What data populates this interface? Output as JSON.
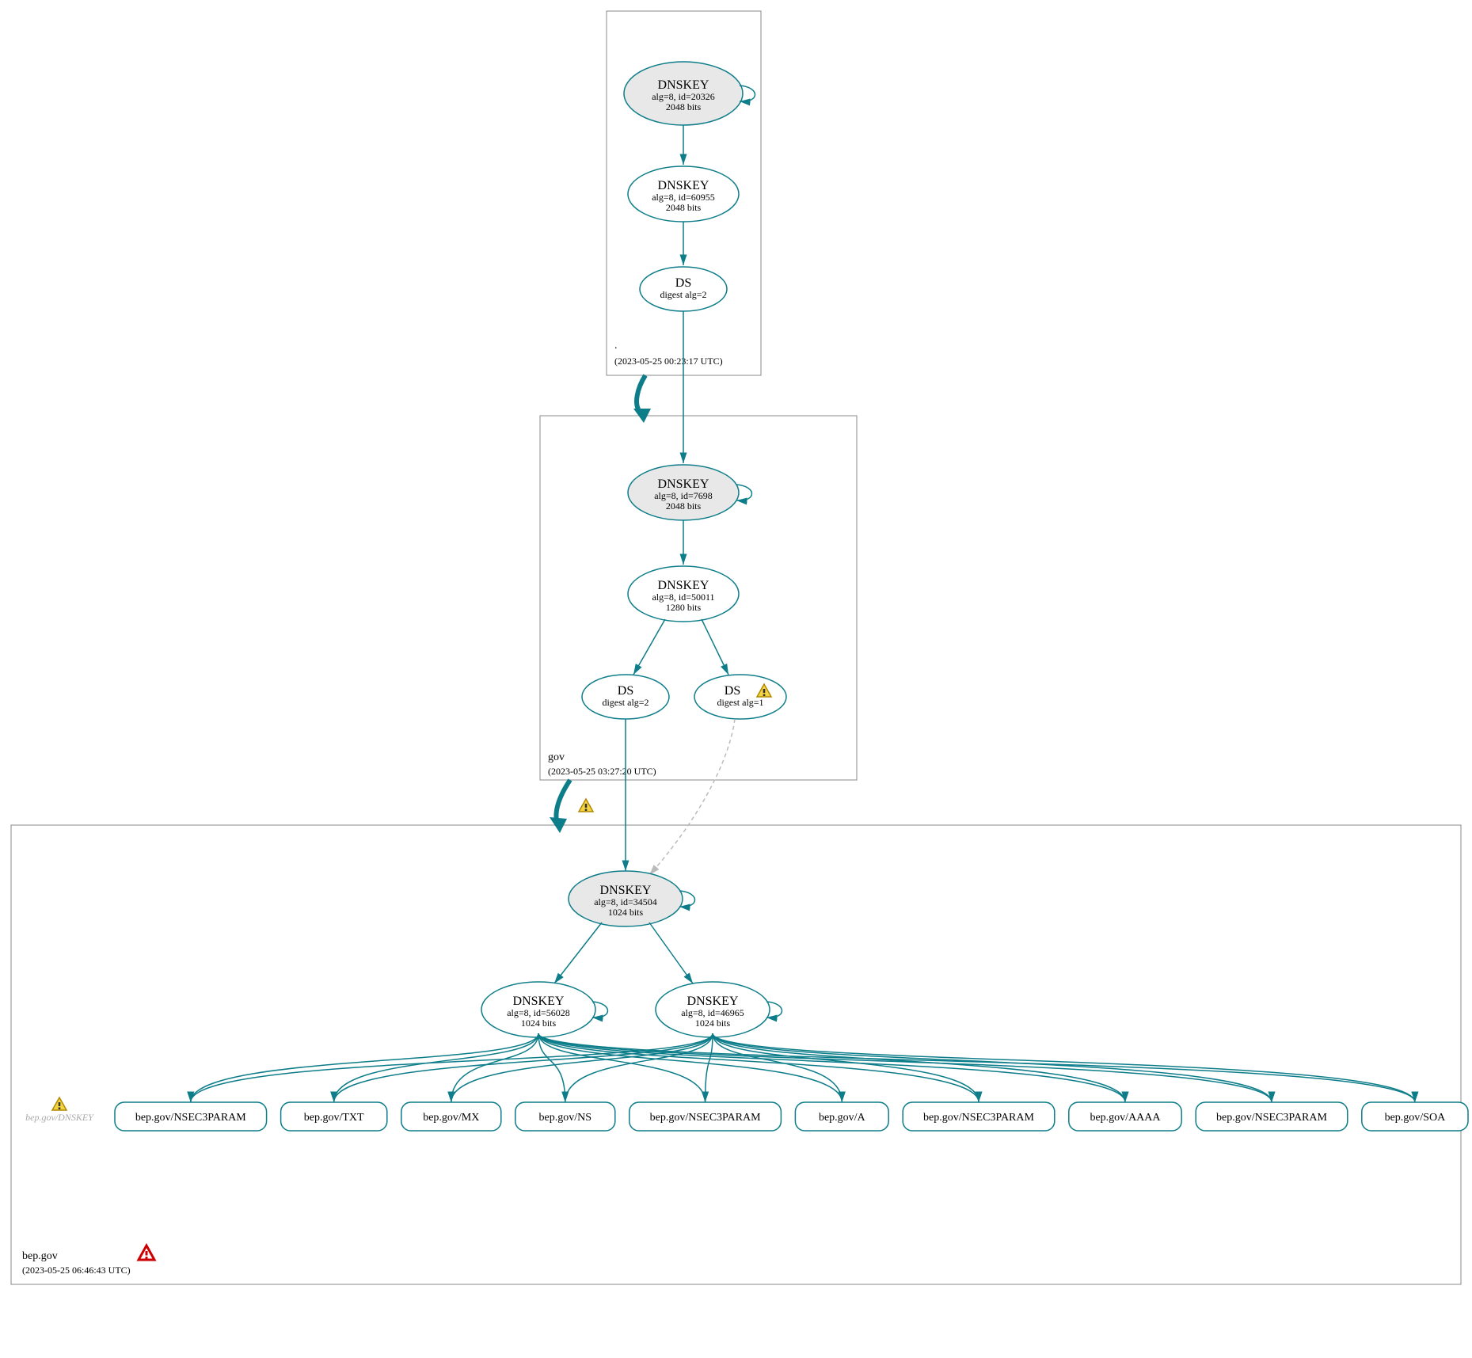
{
  "zones": {
    "root": {
      "name": ".",
      "timestamp": "(2023-05-25 00:23:17 UTC)",
      "nodes": {
        "ksk": {
          "title": "DNSKEY",
          "sub1": "alg=8, id=20326",
          "sub2": "2048 bits"
        },
        "zsk": {
          "title": "DNSKEY",
          "sub1": "alg=8, id=60955",
          "sub2": "2048 bits"
        },
        "ds": {
          "title": "DS",
          "sub1": "digest alg=2"
        }
      }
    },
    "gov": {
      "name": "gov",
      "timestamp": "(2023-05-25 03:27:20 UTC)",
      "nodes": {
        "ksk": {
          "title": "DNSKEY",
          "sub1": "alg=8, id=7698",
          "sub2": "2048 bits"
        },
        "zsk": {
          "title": "DNSKEY",
          "sub1": "alg=8, id=50011",
          "sub2": "1280 bits"
        },
        "ds1": {
          "title": "DS",
          "sub1": "digest alg=2"
        },
        "ds2": {
          "title": "DS",
          "sub1": "digest alg=1"
        }
      }
    },
    "bep": {
      "name": "bep.gov",
      "timestamp": "(2023-05-25 06:46:43 UTC)",
      "nodes": {
        "ksk": {
          "title": "DNSKEY",
          "sub1": "alg=8, id=34504",
          "sub2": "1024 bits"
        },
        "zsk1": {
          "title": "DNSKEY",
          "sub1": "alg=8, id=56028",
          "sub2": "1024 bits"
        },
        "zsk2": {
          "title": "DNSKEY",
          "sub1": "alg=8, id=46965",
          "sub2": "1024 bits"
        }
      },
      "extra_dnskey_label": "bep.gov/DNSKEY",
      "rrsets": [
        "bep.gov/NSEC3PARAM",
        "bep.gov/TXT",
        "bep.gov/MX",
        "bep.gov/NS",
        "bep.gov/NSEC3PARAM",
        "bep.gov/A",
        "bep.gov/NSEC3PARAM",
        "bep.gov/AAAA",
        "bep.gov/NSEC3PARAM",
        "bep.gov/SOA"
      ]
    }
  }
}
